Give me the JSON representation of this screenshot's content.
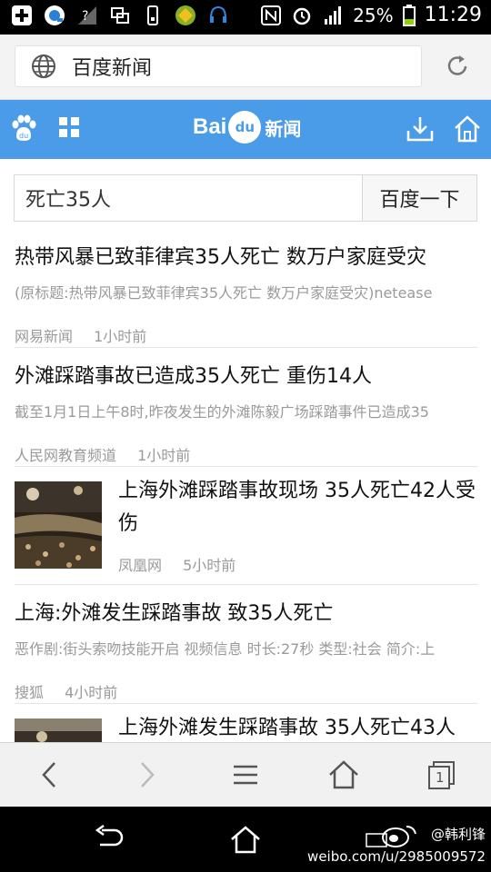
{
  "status_bar": {
    "battery": "25%",
    "time": "11:29",
    "icons": [
      "plus-icon",
      "browser-icon",
      "signal-unknown-icon",
      "screen-icon",
      "phone-icon",
      "app-icon",
      "headset-icon",
      "nfc-icon",
      "alarm-icon",
      "cell-signal-icon",
      "battery-icon"
    ]
  },
  "address_bar": {
    "url": "百度新闻",
    "icons": [
      "globe-icon",
      "reload-icon"
    ]
  },
  "header": {
    "logo_bai": "Bai",
    "logo_du": "du",
    "logo_news": "新闻",
    "accent": "#4a9be8"
  },
  "search": {
    "query": "死亡35人",
    "button": "百度一下"
  },
  "news": [
    {
      "title": "热带风暴已致菲律宾35人死亡 数万户家庭受灾",
      "abstract": "(原标题:热带风暴已致菲律宾35人死亡 数万户家庭受灾)netease",
      "source": "网易新闻",
      "time": "1小时前"
    },
    {
      "title": "外滩踩踏事故已造成35人死亡 重伤14人",
      "abstract": "截至1月1日上午8时,昨夜发生的外滩陈毅广场踩踏事件已造成35",
      "source": "人民网教育频道",
      "time": "1小时前"
    },
    {
      "title": "上海外滩踩踏事故现场 35人死亡42人受伤",
      "source": "凤凰网",
      "time": "5小时前"
    },
    {
      "title": "上海:外滩发生踩踏事故 致35人死亡",
      "abstract": "恶作剧:街头索吻技能开启 视频信息 时长:27秒 类型:社会 简介:上",
      "source": "搜狐",
      "time": "4小时前"
    },
    {
      "title": "上海外滩发生踩踏事故 35人死亡43人"
    }
  ],
  "toolbar": {
    "items": [
      "back-icon",
      "forward-icon",
      "menu-icon",
      "home-icon",
      "tabs-icon"
    ],
    "tab_count": "1"
  },
  "watermark": {
    "handle": "@韩利锋",
    "url": "weibo.com/u/2985009572"
  }
}
